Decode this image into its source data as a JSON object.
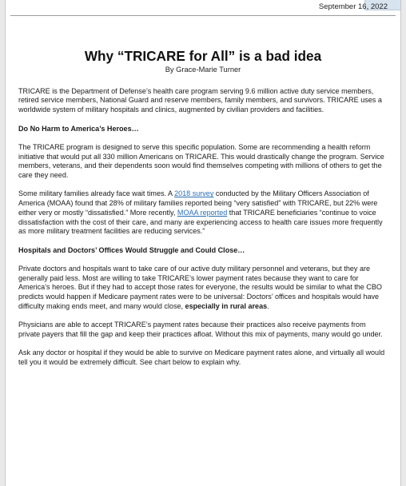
{
  "header": {
    "date": "September 16, 2022"
  },
  "article": {
    "title": "Why “TRICARE for All” is a bad idea",
    "byline": "By Grace-Marie Turner",
    "intro": "TRICARE is the Department of Defense’s health care program serving 9.6 million active duty service members, retired service members, National Guard and reserve members, family members, and survivors.  TRICARE uses a worldwide system of military hospitals and clinics, augmented by civilian providers and facilities.",
    "section1": {
      "heading": "Do No Harm to America’s Heroes…",
      "p1": "The TRICARE program is designed to serve this specific population.  Some are recommending a health reform initiative that would put all 330 million Americans on TRICARE. This would drastically change the program. Service members, veterans, and their dependents soon would find themselves competing with millions of others to get the care they need.",
      "p2_part1": "Some military families already face wait times.  A ",
      "p2_link1": "2018 survey",
      "p2_part2": " conducted by the Military Officers Association of America (MOAA) found that 28% of military families reported being “very satisfied” with TRICARE, but 22% were either very or mostly “dissatisfied.”  More recently, ",
      "p2_link2": "MOAA reported",
      "p2_part3": " that TRICARE beneficiaries “continue to voice dissatisfaction with the cost of their care, and many are experiencing access to health care issues more frequently as more military treatment facilities are reducing services.”"
    },
    "section2": {
      "heading": "Hospitals and Doctors’ Offices Would Struggle and Could Close…",
      "p1_part1": "Private doctors and hospitals want to take care of our active duty military personnel and veterans, but they are generally paid less. Most are willing to take TRICARE’s lower payment rates because they want to care for America’s heroes. But if they had to accept those rates for everyone, the results would be similar to what the CBO predicts would happen if Medicare payment rates were to be universal: Doctors’ offices and hospitals would have difficulty making ends meet, and many would close, ",
      "p1_bold": "especially in rural areas",
      "p1_part2": ".",
      "p2": "Physicians are able to accept TRICARE’s payment rates because their practices also receive payments from private payers that fill the gap and keep their practices afloat.  Without this mix of payments, many would go under.",
      "p3": "Ask any doctor or hospital if they would be able to survive on Medicare payment rates alone, and virtually all would tell you it would be extremely difficult.  See chart below to explain why."
    }
  }
}
